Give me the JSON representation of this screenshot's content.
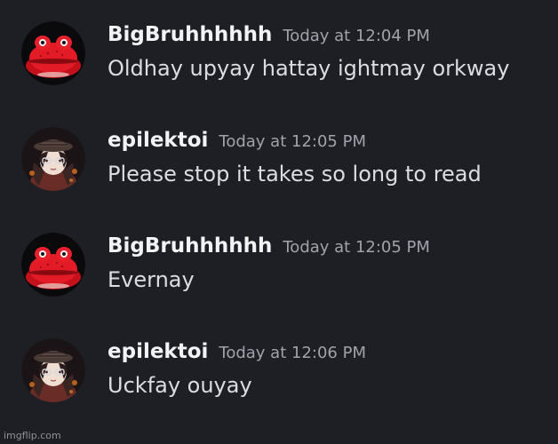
{
  "messages": [
    {
      "username": "BigBruhhhhhh",
      "timestamp": "Today at 12:04 PM",
      "content": "Oldhay upyay hattay ightmay orkway",
      "avatar_icon": "red-frog-avatar-icon"
    },
    {
      "username": "epilektoi",
      "timestamp": "Today at 12:05 PM",
      "content": "Please stop it takes so long to read",
      "avatar_icon": "anime-character-avatar-icon"
    },
    {
      "username": "BigBruhhhhhh",
      "timestamp": "Today at 12:05 PM",
      "content": "Evernay",
      "avatar_icon": "red-frog-avatar-icon"
    },
    {
      "username": "epilektoi",
      "timestamp": "Today at 12:06 PM",
      "content": "Uckfay ouyay",
      "avatar_icon": "anime-character-avatar-icon"
    }
  ],
  "watermark": "imgflip.com",
  "colors": {
    "background": "#1e1f24",
    "username": "#f2f3f5",
    "timestamp": "#a0a3ab",
    "message_text": "#dbdee1",
    "frog_red": "#d7141f"
  }
}
